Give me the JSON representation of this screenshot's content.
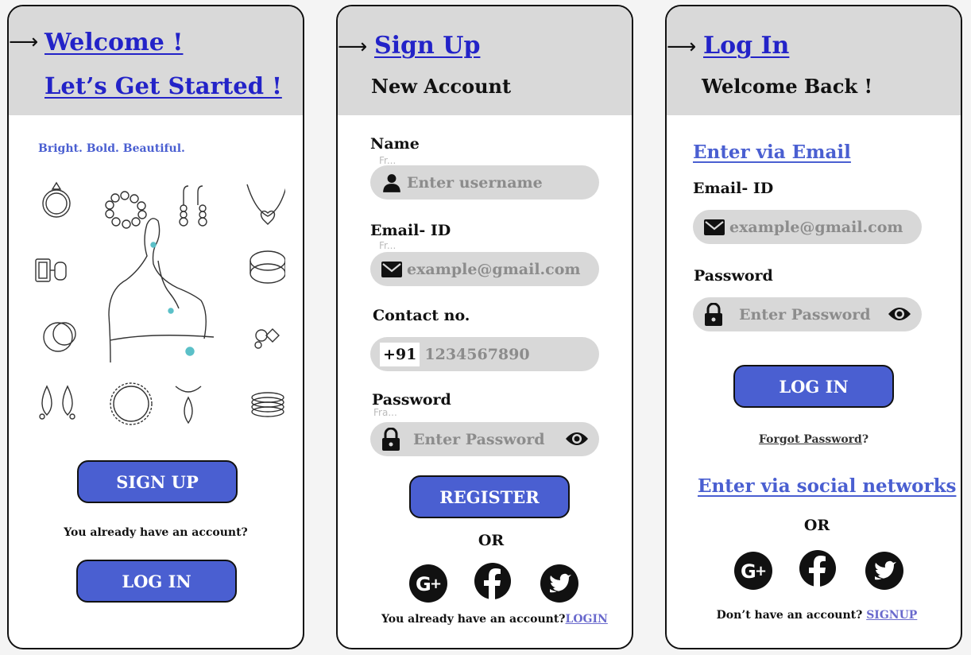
{
  "welcome": {
    "title": "Welcome !",
    "subtitle": "Let’s Get Started !",
    "tagline": "Bright. Bold. Beautiful.",
    "signup_button": "SIGN UP",
    "have_account": "You already have an account?",
    "login_button": "LOG IN"
  },
  "signup": {
    "title": "Sign Up",
    "subtitle": "New Account",
    "name_label": "Name",
    "name_hint": "Fr...",
    "name_placeholder": "Enter username",
    "email_label": "Email- ID",
    "email_hint": "Fr...",
    "email_placeholder": "example@gmail.com",
    "contact_label": "Contact no.",
    "country_code": "+91",
    "phone_placeholder": "1234567890",
    "password_label": "Password",
    "password_hint": "Fra...",
    "password_placeholder": "Enter Password",
    "register_button": "REGISTER",
    "or_text": "OR",
    "have_account": "You already have an account?",
    "login_link": "LOGIN"
  },
  "login": {
    "title": "Log In",
    "subtitle": "Welcome Back !",
    "email_section": "Enter  via Email",
    "email_label": "Email- ID",
    "email_placeholder": "example@gmail.com",
    "password_label": "Password",
    "password_placeholder": "Enter Password",
    "login_button": "LOG IN",
    "forgot_password": "Forgot Password",
    "forgot_suffix": "?",
    "social_section": "Enter  via social networks",
    "or_text": "OR",
    "no_account": "Don’t have an account?",
    "signup_link": "SIGNUP"
  },
  "icons": [
    "arrow-right-icon",
    "user-icon",
    "mail-icon",
    "lock-icon",
    "eye-icon",
    "google-plus-icon",
    "facebook-icon",
    "twitter-icon"
  ],
  "colors": {
    "accent": "#4a5fd1",
    "title": "#2323c8",
    "header_bg": "#d9d9d9",
    "field_bg": "#d8d8d8"
  }
}
